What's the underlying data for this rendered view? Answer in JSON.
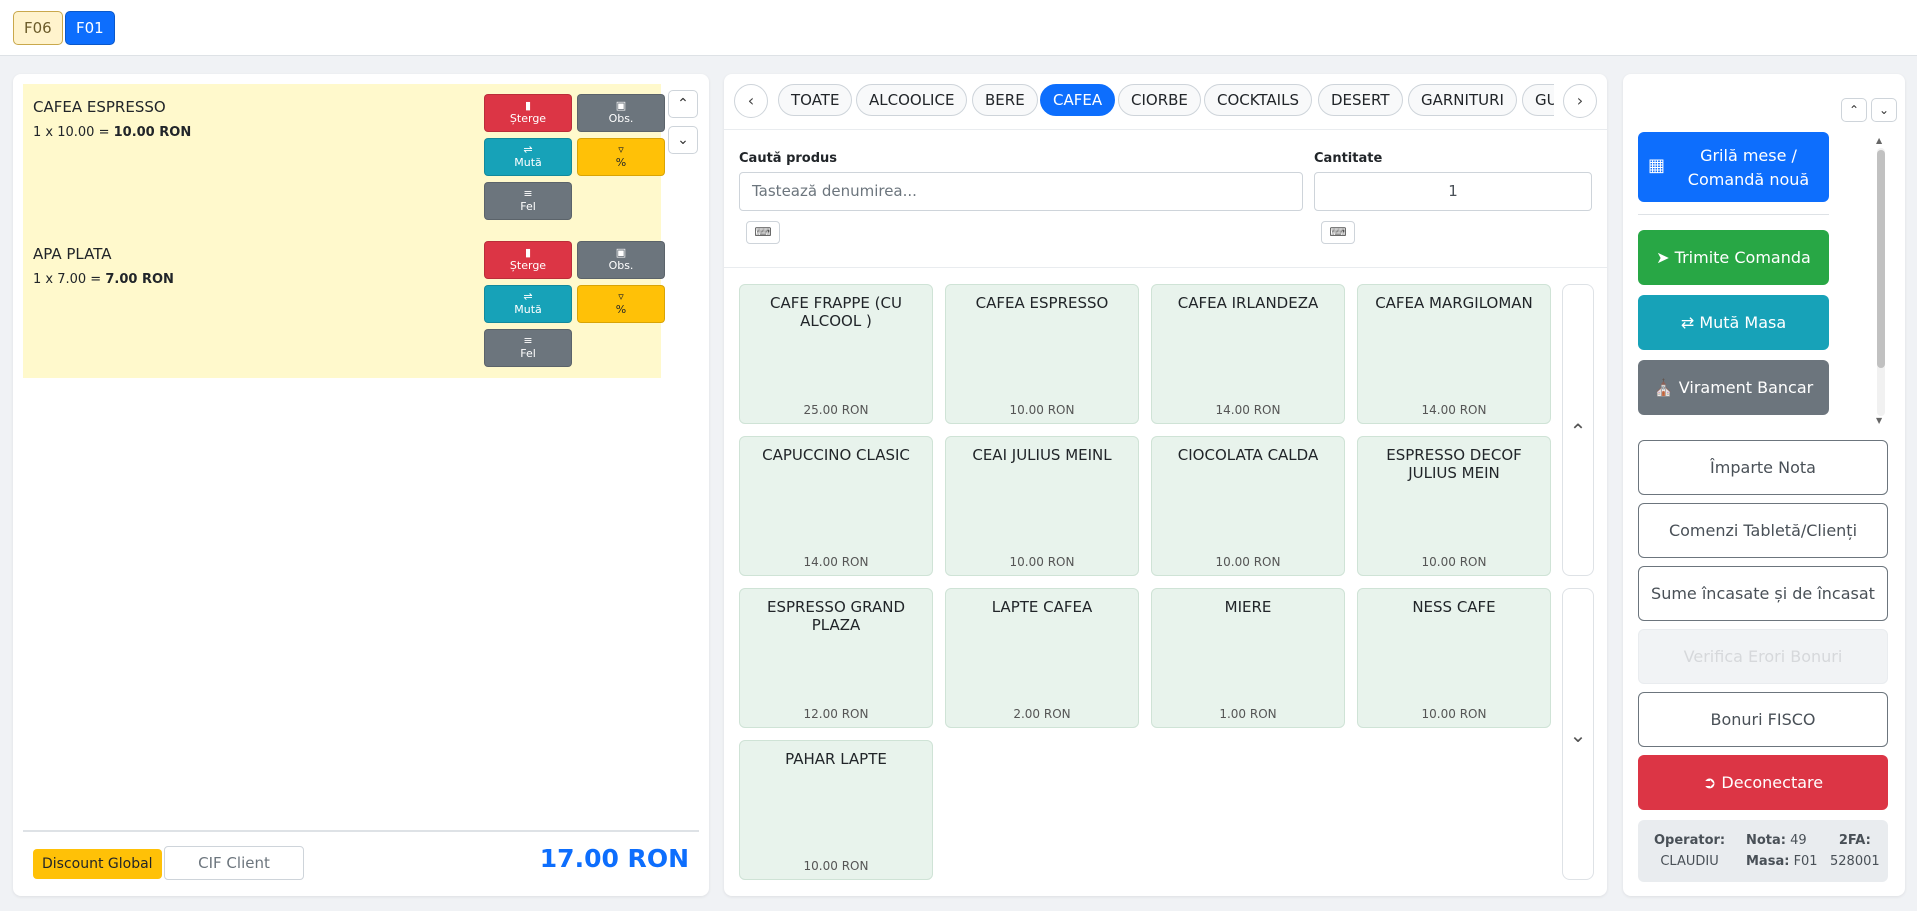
{
  "tabs": [
    {
      "label": "F06",
      "active": false
    },
    {
      "label": "F01",
      "active": true
    }
  ],
  "order": {
    "items": [
      {
        "name": "CAFEA ESPRESSO",
        "line_prefix": "1 x 10.00 = ",
        "line_total": "10.00 RON"
      },
      {
        "name": "APA PLATA",
        "line_prefix": "1 x 7.00 = ",
        "line_total": "7.00 RON"
      }
    ],
    "buttons": {
      "delete": "Șterge",
      "obs": "Obs.",
      "move": "Mută",
      "percent": "%",
      "fel": "Fel"
    },
    "discount_label": "Discount Global",
    "cif_label": "CIF Client",
    "total": "17.00 RON"
  },
  "categories": [
    {
      "label": "TOATE",
      "active": false
    },
    {
      "label": "ALCOOLICE",
      "active": false
    },
    {
      "label": "BERE",
      "active": false
    },
    {
      "label": "CAFEA",
      "active": true
    },
    {
      "label": "CIORBE",
      "active": false
    },
    {
      "label": "COCKTAILS",
      "active": false
    },
    {
      "label": "DESERT",
      "active": false
    },
    {
      "label": "GARNITURI",
      "active": false
    },
    {
      "label": "GU",
      "active": false
    }
  ],
  "search": {
    "product_label": "Caută produs",
    "product_placeholder": "Tastează denumirea...",
    "qty_label": "Cantitate",
    "qty_value": "1"
  },
  "products": [
    {
      "name": "CAFE FRAPPE (CU ALCOOL )",
      "price": "25.00 RON"
    },
    {
      "name": "CAFEA ESPRESSO",
      "price": "10.00 RON"
    },
    {
      "name": "CAFEA IRLANDEZA",
      "price": "14.00 RON"
    },
    {
      "name": "CAFEA MARGILOMAN",
      "price": "14.00 RON"
    },
    {
      "name": "CAPUCCINO CLASIC",
      "price": "14.00 RON"
    },
    {
      "name": "CEAI JULIUS MEINL",
      "price": "10.00 RON"
    },
    {
      "name": "CIOCOLATA CALDA",
      "price": "10.00 RON"
    },
    {
      "name": "ESPRESSO DECOF JULIUS MEIN",
      "price": "10.00 RON"
    },
    {
      "name": "ESPRESSO GRAND PLAZA",
      "price": "12.00 RON"
    },
    {
      "name": "LAPTE CAFEA",
      "price": "2.00 RON"
    },
    {
      "name": "MIERE",
      "price": "1.00 RON"
    },
    {
      "name": "NESS CAFE",
      "price": "10.00 RON"
    },
    {
      "name": "PAHAR LAPTE",
      "price": "10.00 RON"
    }
  ],
  "actions": {
    "grid": "Grilă mese / Comandă nouă",
    "send": "Trimite Comanda",
    "move_table": "Mută Masa",
    "bank": "Virament Bancar",
    "split": "Împarte Nota",
    "tablet": "Comenzi Tabletă/Clienți",
    "sums": "Sume încasate și de încasat",
    "errors": "Verifica Erori Bonuri",
    "fisco": "Bonuri FISCO",
    "logout": "Deconectare"
  },
  "info": {
    "operator_label": "Operator:",
    "operator_value": "CLAUDIU",
    "nota_label": "Nota:",
    "nota_value": "49",
    "masa_label": "Masa:",
    "masa_value": "F01",
    "twofa_label": "2FA:",
    "twofa_value": "528001"
  },
  "colors": {
    "primary": "#0d6efd",
    "success": "#28a745",
    "info": "#17a2b8",
    "secondary": "#6c757d",
    "danger": "#dc3545",
    "warning": "#ffc107",
    "order_bg": "#fff9cc",
    "product_bg": "#e8f3ec"
  }
}
